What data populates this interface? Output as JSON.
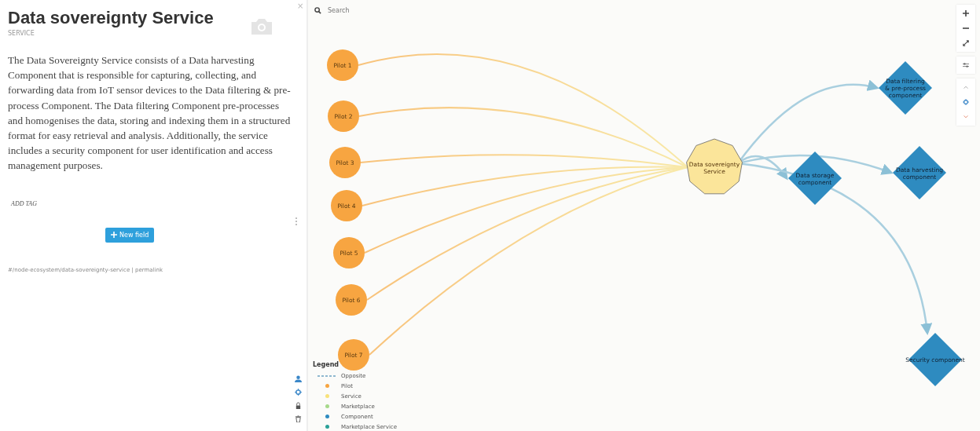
{
  "panel": {
    "title": "Data sovereignty Service",
    "subtitle": "SERVICE",
    "close": "×",
    "description": "The Data Sovereignty Service consists of a Data harvesting Component that is responsible for capturing, collecting, and forwarding data from IoT sensor devices to the Data filtering & pre-process Component. The Data filtering Component pre-processes and homogenises the data, storing and indexing them in a structured format for easy retrieval and analysis. Additionally, the service includes a security component for user identification and access management purposes.",
    "add_tag": "ADD TAG",
    "new_field_button": "New field",
    "path": "#/node-ecosystem/data-sovereignty-service | permalink"
  },
  "graph": {
    "search": {
      "placeholder": "Search"
    },
    "nodes": [
      {
        "kind": "pilot",
        "lines": [
          "Pilot 1"
        ]
      },
      {
        "kind": "pilot",
        "lines": [
          "Pilot 2"
        ]
      },
      {
        "kind": "pilot",
        "lines": [
          "Pilot 3"
        ]
      },
      {
        "kind": "pilot",
        "lines": [
          "Pilot 4"
        ]
      },
      {
        "kind": "pilot",
        "lines": [
          "Pilot 5"
        ]
      },
      {
        "kind": "pilot",
        "lines": [
          "Pilot 6"
        ]
      },
      {
        "kind": "pilot",
        "lines": [
          "Pilot 7"
        ]
      },
      {
        "kind": "service",
        "lines": [
          "Data sovereignty",
          "Service"
        ]
      },
      {
        "kind": "component",
        "lines": [
          "Data filtering",
          "& pre-process",
          "component"
        ]
      },
      {
        "kind": "component",
        "lines": [
          "Data storage",
          "component"
        ]
      },
      {
        "kind": "component",
        "lines": [
          "Data harvesting",
          "component"
        ]
      },
      {
        "kind": "component",
        "lines": [
          "Security component"
        ]
      }
    ],
    "legend": {
      "title": "Legend",
      "items": [
        {
          "kind": "line",
          "label": "Opposite",
          "color": "#8fb8d0"
        },
        {
          "kind": "dot",
          "label": "Pilot",
          "color": "#f7a541"
        },
        {
          "kind": "dot",
          "label": "Service",
          "color": "#f8e27a"
        },
        {
          "kind": "dot",
          "label": "Marketplace",
          "color": "#a6d98a"
        },
        {
          "kind": "dot",
          "label": "Component",
          "color": "#2e8bc0"
        },
        {
          "kind": "dot",
          "label": "Marketplace Service",
          "color": "#2aa198"
        }
      ]
    }
  }
}
